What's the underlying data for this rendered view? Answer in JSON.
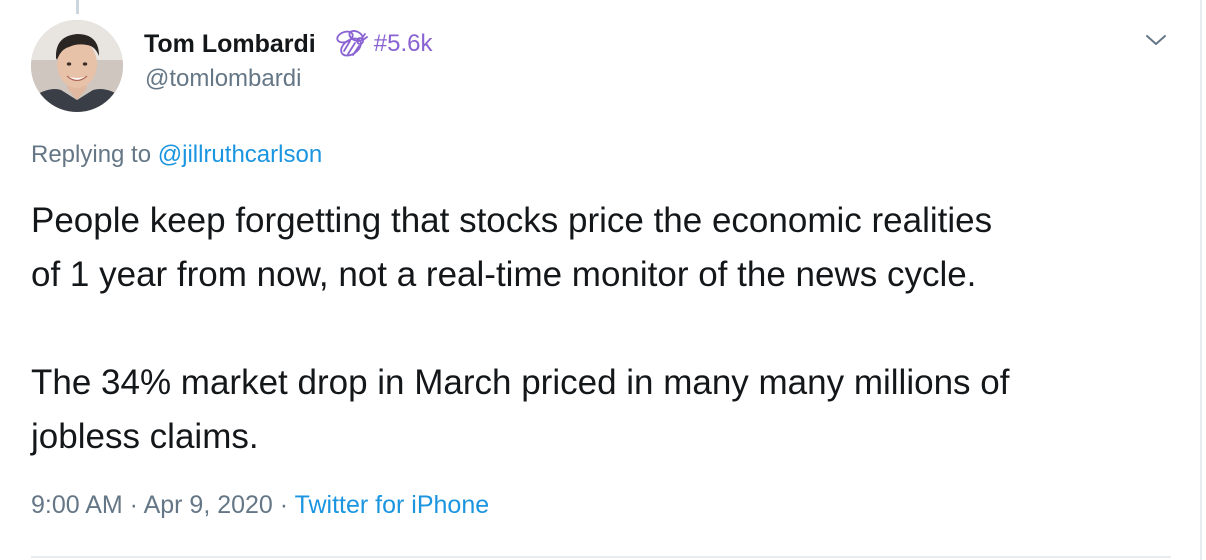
{
  "author": {
    "display_name": "Tom Lombardi",
    "handle": "@tomlombardi",
    "badge_icon": "bee-icon",
    "badge_text": "#5.6k",
    "badge_color": "#8a63d2"
  },
  "reply": {
    "prefix": "Replying to ",
    "mention": "@jillruthcarlson"
  },
  "tweet": {
    "paragraph_1_line_1": "People keep forgetting that stocks price the economic realities",
    "paragraph_1_line_2": "of 1 year from now, not a real-time monitor of the news cycle.",
    "paragraph_2_line_1": "The 34% market drop in March priced in many many millions of",
    "paragraph_2_line_2": "jobless claims."
  },
  "meta": {
    "time": "9:00 AM",
    "separator": " · ",
    "date": "Apr 9, 2020",
    "source": "Twitter for iPhone"
  },
  "icons": {
    "menu": "chevron-down-icon",
    "avatar": "avatar"
  },
  "colors": {
    "link": "#1b95e0",
    "secondary_text": "#657786",
    "primary_text": "#14171a"
  }
}
